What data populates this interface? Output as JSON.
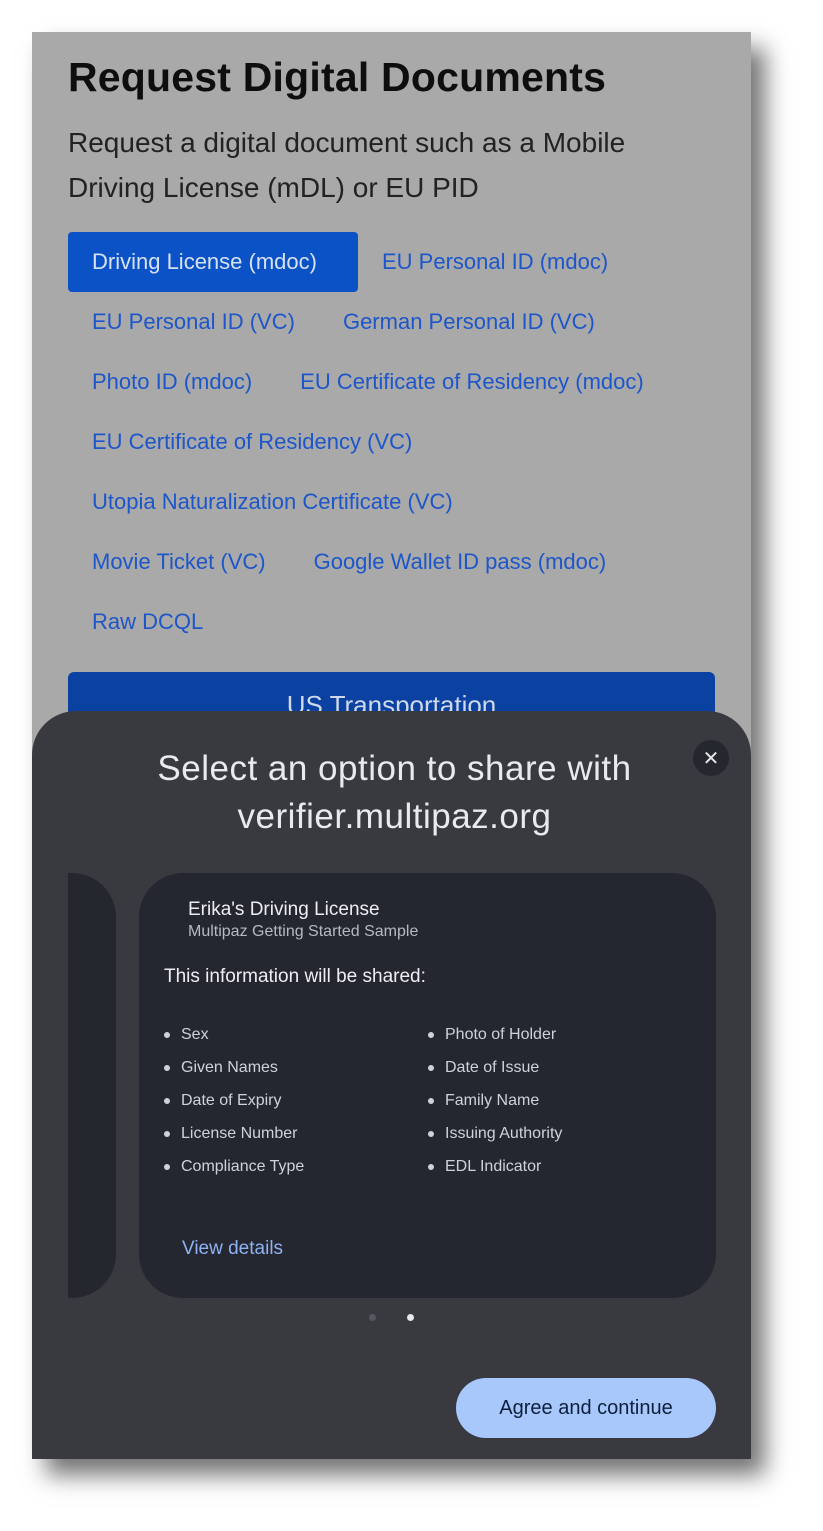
{
  "page": {
    "title": "Request Digital Documents",
    "description": "Request a digital document such as a Mobile Driving License (mDL) or EU PID",
    "chip_rows": [
      [
        "Driving License (mdoc)",
        "EU Personal ID (mdoc)"
      ],
      [
        "EU Personal ID (VC)",
        "German Personal ID (VC)"
      ],
      [
        "Photo ID (mdoc)",
        "EU Certificate of Residency (mdoc)"
      ],
      [
        "EU Certificate of Residency (VC)"
      ],
      [
        "Utopia Naturalization Certificate (VC)"
      ],
      [
        "Movie Ticket (VC)",
        "Google Wallet ID pass (mdoc)"
      ],
      [
        "Raw DCQL"
      ]
    ],
    "selected_chip": "Driving License (mdoc)",
    "partial_button": "US Transportation"
  },
  "sheet": {
    "close_icon": "close-icon",
    "title": "Select an option to share with verifier.multipaz.org",
    "card": {
      "title": "Erika's Driving License",
      "subtitle": "Multipaz Getting Started Sample",
      "shared_heading": "This information will be shared:",
      "left_items": [
        "Sex",
        "Given Names",
        "Date of Expiry",
        "License Number",
        "Compliance Type"
      ],
      "right_items": [
        "Photo of Holder",
        "Date of Issue",
        "Family Name",
        "Issuing Authority",
        "EDL Indicator"
      ],
      "view_details": "View details"
    },
    "pager": {
      "count": 2,
      "active": 2
    },
    "agree_button": "Agree and continue"
  },
  "colors": {
    "accent": "#0b52c6",
    "sheet_bg": "#393a40",
    "card_bg": "#252730",
    "primary_button": "#a8c7fa"
  }
}
